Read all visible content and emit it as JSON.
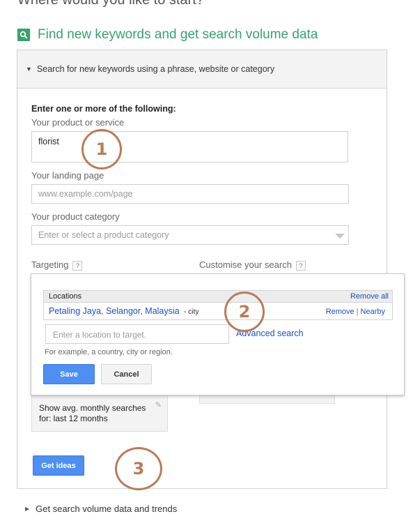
{
  "page": {
    "heading": "Where would you like to start?"
  },
  "section": {
    "icon": "search-icon",
    "title": "Find new keywords and get search volume data",
    "accent_color": "#35a36a"
  },
  "panel": {
    "header": "Search for new keywords using a phrase, website or category",
    "intro": "Enter one or more of the following:",
    "product_label": "Your product or service",
    "product_value": "florist",
    "landing_label": "Your landing page",
    "landing_placeholder": "www.example.com/page",
    "category_label": "Your product category",
    "category_placeholder": "Enter or select a product category",
    "targeting_label": "Targeting",
    "customise_label": "Customise your search",
    "help_glyph": "?",
    "avg_searches_line1": "Show avg. monthly searches",
    "avg_searches_line2": "for: last 12 months",
    "get_ideas": "Get ideas"
  },
  "location_popup": {
    "table_header": "Locations",
    "remove_all": "Remove all",
    "locations": [
      {
        "name": "Petaling Jaya, Selangor, Malaysia",
        "type": "- city",
        "remove": "Remove",
        "nearby": "Nearby"
      }
    ],
    "separator": "|",
    "input_placeholder": "Enter a location to target.",
    "advanced_search": "Advanced search",
    "hint": "For example, a country, city or region.",
    "save": "Save",
    "cancel": "Cancel"
  },
  "annotations": [
    "1",
    "2",
    "3"
  ],
  "annotation_color": "#b97b58",
  "collapsed_section": "Get search volume data and trends"
}
